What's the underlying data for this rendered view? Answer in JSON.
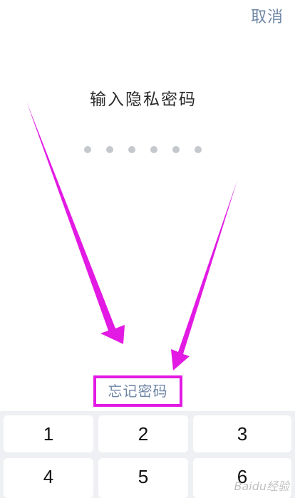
{
  "header": {
    "cancel_label": "取消"
  },
  "prompt": {
    "title": "输入隐私密码",
    "dots_count": 6
  },
  "forgot": {
    "label": "忘记密码"
  },
  "keypad": {
    "keys": [
      "1",
      "2",
      "3",
      "4",
      "5",
      "6"
    ]
  },
  "annotation": {
    "color": "#e21ae3"
  },
  "watermark": {
    "text": "Baidu经验"
  }
}
